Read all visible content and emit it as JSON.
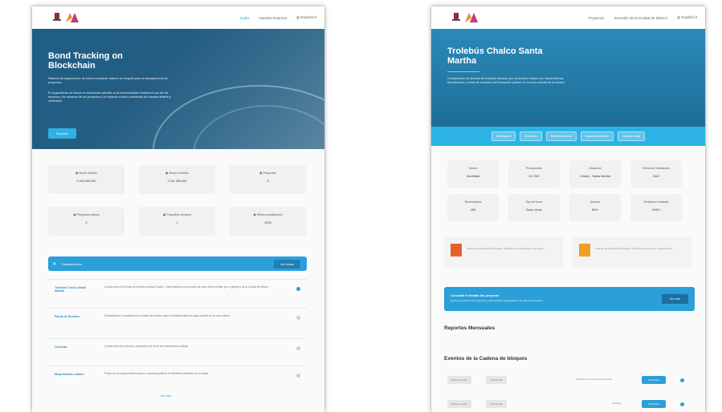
{
  "left_page": {
    "nav": {
      "links": [
        "Inglés",
        "Nuestra empresa"
      ],
      "language": "Español"
    },
    "hero": {
      "title_line1": "Bond Tracking on",
      "title_line2": "Blockchain",
      "intro": "Sistema de seguimiento de bonos mediante cadena de bloques para la transparencia en proyectos.",
      "body": "El seguimiento de bonos en blockchain permite a los inversionistas verificar el uso de los recursos, los avances de los proyectos y el impacto social y ambiental de manera abierta y verificable.",
      "button": "Explorar"
    },
    "stats": [
      {
        "label": "Monto emitido",
        "value": "2 000 000 000"
      },
      {
        "label": "Monto invertido",
        "value": "1 011 000 000"
      },
      {
        "label": "Proyectos",
        "value": "3"
      },
      {
        "label": "Proyectos activos",
        "value": "2"
      },
      {
        "label": "Proyectos cerrados",
        "value": "1"
      },
      {
        "label": "Última actualización",
        "value": "2020"
      }
    ],
    "transactions_header": {
      "title": "Transacciones",
      "button": "Ver todas"
    },
    "transactions": [
      {
        "name": "Trolebús Chalco Santa Martha",
        "desc": "Construcción de la línea de trolebús elevado Chalco - Santa Martha con recursos del bono verde emitido por el gobierno de la Ciudad de México."
      },
      {
        "name": "Planta de Bombeo",
        "desc": "Rehabilitación y ampliación de la planta de bombeo para el abastecimiento de agua potable en la zona oriente."
      },
      {
        "name": "Ciclovías",
        "desc": "Construcción de ciclovías y ampliación de la red de infraestructura ciclista."
      },
      {
        "name": "Mejoramiento urbano",
        "desc": "Proyectos de mejoramiento urbano y espacios públicos en diferentes alcaldías de la ciudad."
      }
    ],
    "show_more": "Ver más"
  },
  "right_page": {
    "nav": {
      "links": [
        "Proyectos",
        "Inversión de la Ciudad de México"
      ],
      "language": "Español"
    },
    "hero": {
      "title_line1": "Trolebús Chalco Santa",
      "title_line2": "Martha",
      "body": "Construcción de la línea de trolebús elevado que conectará Chalco con Santa Martha, beneficiando a miles de usuarios del transporte público en la zona oriente de la ciudad."
    },
    "tags": [
      "Descripción",
      "Ubicación",
      "Detalles técnicos",
      "Impacto ambiental",
      "Impacto social"
    ],
    "stats": [
      {
        "label": "Sector",
        "value": "Movilidad"
      },
      {
        "label": "Presupuesto",
        "value": "$ 1 000"
      },
      {
        "label": "Ubicación",
        "value": "Chalco - Santa Martha"
      },
      {
        "label": "Fecha de finalización",
        "value": "2022"
      },
      {
        "label": "Beneficiarios",
        "value": "250"
      },
      {
        "label": "Tipo de bono",
        "value": "Bono verde"
      },
      {
        "label": "Avance",
        "value": "80%"
      },
      {
        "label": "Emisiones evitadas",
        "value": "1000 t"
      }
    ],
    "sdgs": [
      {
        "color": "#e5612b",
        "text": "Objetivo de Desarrollo Sostenible: Ciudades y comunidades sostenibles."
      },
      {
        "color": "#f29e1f",
        "text": "Objetivo de Desarrollo Sostenible: Industria, innovación e infraestructura."
      }
    ],
    "cta": {
      "title": "Consulta el detalle del proyecto",
      "subtitle": "Revisa los documentos, reportes y transacciones registradas en la cadena de bloques.",
      "button": "Ver más"
    },
    "reports_title": "Reportes Mensuales",
    "events_title": "Eventos de la Cadena de bloques",
    "events": [
      {
        "pill1": "Bloque minado",
        "pill2": "Transacción",
        "text": "Validado en la cadena de bloques",
        "button": "Ver bloque"
      },
      {
        "pill1": "Bloque minado",
        "pill2": "Transacción",
        "text": "Validado",
        "button": "Ver bloque"
      }
    ]
  },
  "colors": {
    "accent": "#2b9fd8",
    "hero_dark": "#1e5f87",
    "tag_bar": "#2cb2e4"
  }
}
